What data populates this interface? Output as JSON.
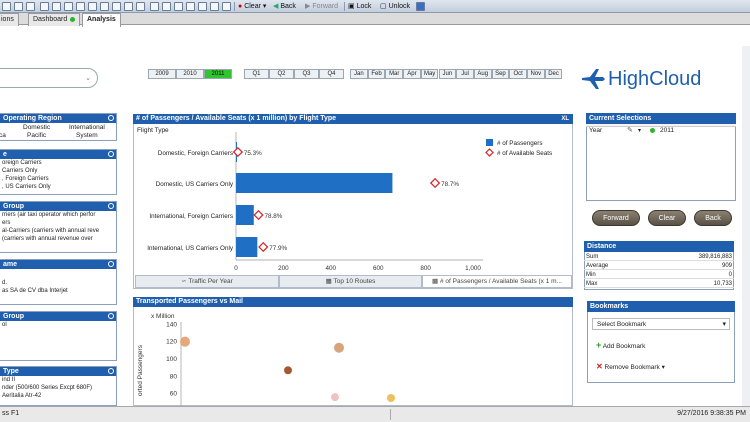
{
  "toolbar": {
    "clear_label": "Clear",
    "back_label": "Back",
    "forward_label": "Forward",
    "lock_label": "Lock",
    "unlock_label": "Unlock"
  },
  "tabs": [
    {
      "label": "ions"
    },
    {
      "label": "Dashboard"
    },
    {
      "label": "Analysis"
    }
  ],
  "years": [
    "2009",
    "2010",
    "2011"
  ],
  "selected_year": "2011",
  "quarters": [
    "Q1",
    "Q2",
    "Q3",
    "Q4"
  ],
  "months": [
    "Jan",
    "Feb",
    "Mar",
    "Apr",
    "May",
    "Jun",
    "Jul",
    "Aug",
    "Sep",
    "Oct",
    "Nov",
    "Dec"
  ],
  "logo_text": "HighCloud",
  "listboxes": {
    "operating_region": {
      "title": "Operating Region",
      "items": [
        "Domestic",
        "International",
        "ca",
        "Pacific",
        "System"
      ]
    },
    "box2": {
      "title": "e",
      "items": [
        "oreign Carriers",
        " Carriers Only",
        ", Foreign Carriers",
        ", US Carriers Only"
      ]
    },
    "box3": {
      "title": "Group",
      "items": [
        "rriers (air taxi operator which perfor",
        "ers",
        "al-Carriers (carriers with annual reve",
        "(carriers with annual revenue over"
      ]
    },
    "box4": {
      "title": "ame",
      "items": [
        "d.",
        "as SA de CV dba Interjet"
      ]
    },
    "box5": {
      "title": "Group",
      "items": [
        "ol"
      ]
    },
    "box6": {
      "title": "Type",
      "items": [
        "ind II",
        "nder (500/600 Series Excpt 680F)",
        "Aeritalia Atr-42"
      ]
    }
  },
  "main_chart": {
    "title": "# of Passengers / Available Seats (x 1 million) by Flight Type",
    "controls": "XL",
    "dimension_label": "Flight Type",
    "legend": [
      "# of Passengers",
      "# of Available Seats"
    ],
    "bottom_tabs": [
      "Traffic Per Year",
      "Top 10 Routes",
      "# of Passengers / Available Seats (x 1 m..."
    ]
  },
  "chart_data": [
    {
      "type": "bar",
      "title": "# of Passengers / Available Seats (x 1 million) by Flight Type",
      "categories": [
        "Domestic, Foreign Carriers",
        "Domestic, US Carriers Only",
        "International, Foreign Carriers",
        "International, US Carriers Only"
      ],
      "series": [
        {
          "name": "# of Passengers",
          "values": [
            3,
            660,
            75,
            90
          ]
        },
        {
          "name": "# of Available Seats",
          "values": [
            8,
            840,
            95,
            115
          ]
        }
      ],
      "seat_labels": [
        "75.3%",
        "78.7%",
        "78.8%",
        "77.9%"
      ],
      "xticks": [
        "0",
        "200",
        "400",
        "600",
        "800",
        "1,000"
      ],
      "xlim": [
        0,
        1000
      ],
      "orientation": "horizontal"
    },
    {
      "type": "scatter",
      "title": "Transported Passengers vs Mail",
      "ylabel": "orted Passengers",
      "yunit": "x Million",
      "yticks": [
        "140",
        "120",
        "100",
        "80",
        "60"
      ],
      "ylim": [
        55,
        145
      ],
      "points": [
        {
          "y": 120,
          "color": "#e6a77a"
        },
        {
          "y": 113,
          "color": "#d8a47b"
        },
        {
          "y": 87,
          "color": "#a35a32"
        },
        {
          "y": 56,
          "color": "#f0c3c3"
        },
        {
          "y": 55,
          "color": "#f0c060"
        }
      ]
    }
  ],
  "scatter_title": "Transported Passengers vs Mail",
  "current_selections": {
    "title": "Current Selections",
    "field": "Year",
    "value": "2011"
  },
  "action_buttons": [
    "Forward",
    "Clear",
    "Back"
  ],
  "distance": {
    "title": "Distance",
    "rows": [
      {
        "label": "Sum",
        "value": "389,816,883"
      },
      {
        "label": "Average",
        "value": "909"
      },
      {
        "label": "Min",
        "value": "0"
      },
      {
        "label": "Max",
        "value": "10,733"
      }
    ]
  },
  "bookmarks": {
    "title": "Bookmarks",
    "select_label": "Select Bookmark",
    "add_label": "Add Bookmark",
    "remove_label": "Remove Bookmark"
  },
  "status": {
    "left": "ss F1",
    "right": "9/27/2016 9:38:35 PM"
  },
  "colors": {
    "header_blue": "#1f5fae",
    "bar_blue": "#1f6fc4",
    "selected_green": "#2ec52e",
    "seat_red": "#d62a2a"
  }
}
